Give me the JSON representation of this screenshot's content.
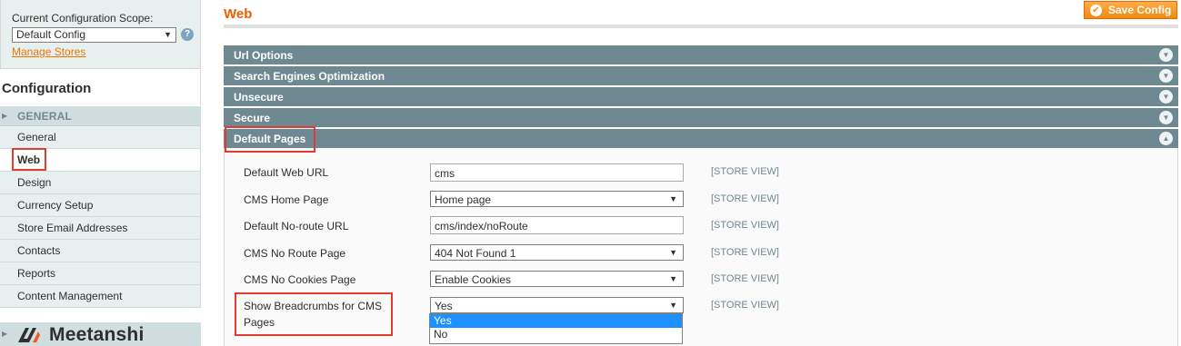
{
  "sidebar": {
    "scope_label": "Current Configuration Scope:",
    "scope_value": "Default Config",
    "manage_stores": "Manage Stores",
    "config_title": "Configuration",
    "group_label": "GENERAL",
    "items": [
      {
        "label": "General",
        "active": false
      },
      {
        "label": "Web",
        "active": true
      },
      {
        "label": "Design",
        "active": false
      },
      {
        "label": "Currency Setup",
        "active": false
      },
      {
        "label": "Store Email Addresses",
        "active": false
      },
      {
        "label": "Contacts",
        "active": false
      },
      {
        "label": "Reports",
        "active": false
      },
      {
        "label": "Content Management",
        "active": false
      }
    ],
    "logo_text": "Meetanshi"
  },
  "main": {
    "title": "Web",
    "save_label": "Save Config",
    "sections": [
      {
        "label": "Url Options",
        "expanded": false
      },
      {
        "label": "Search Engines Optimization",
        "expanded": false
      },
      {
        "label": "Unsecure",
        "expanded": false
      },
      {
        "label": "Secure",
        "expanded": false
      },
      {
        "label": "Default Pages",
        "expanded": true
      }
    ],
    "fields": [
      {
        "label": "Default Web URL",
        "type": "text",
        "value": "cms",
        "scope": "[STORE VIEW]"
      },
      {
        "label": "CMS Home Page",
        "type": "select",
        "value": "Home page",
        "scope": "[STORE VIEW]"
      },
      {
        "label": "Default No-route URL",
        "type": "text",
        "value": "cms/index/noRoute",
        "scope": "[STORE VIEW]"
      },
      {
        "label": "CMS No Route Page",
        "type": "select",
        "value": "404 Not Found 1",
        "scope": "[STORE VIEW]"
      },
      {
        "label": "CMS No Cookies Page",
        "type": "select",
        "value": "Enable Cookies",
        "scope": "[STORE VIEW]"
      },
      {
        "label_line1": "Show Breadcrumbs for CMS",
        "label_line2": "Pages",
        "type": "select",
        "value": "Yes",
        "scope": "[STORE VIEW]"
      }
    ],
    "dropdown_options": [
      "Yes",
      "No"
    ],
    "dropdown_selected": "Yes"
  },
  "colors": {
    "accent_orange": "#eb5e00",
    "section_bar": "#6f8992",
    "highlight_red": "#e03c31",
    "sidebar_bg": "#e7efef"
  }
}
